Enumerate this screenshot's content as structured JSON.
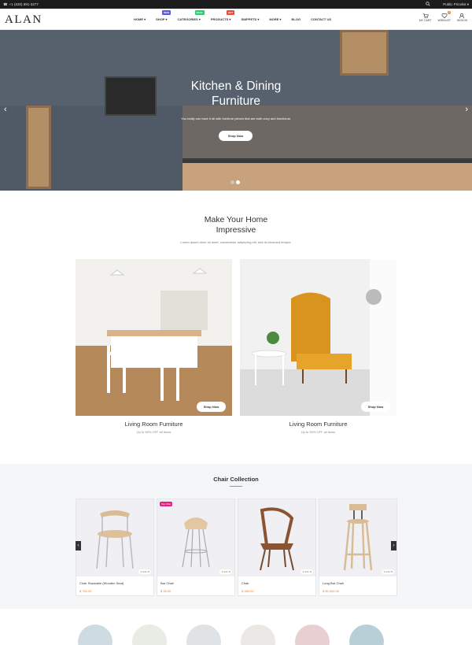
{
  "topbar": {
    "phone": "+1 (630) 891-3277",
    "pricelist": "Public Pricelist"
  },
  "header": {
    "logo": "ALAN",
    "nav": [
      {
        "label": "HOME",
        "caret": "▾",
        "badge": ""
      },
      {
        "label": "SHOP",
        "caret": "▾",
        "badge": "NEW"
      },
      {
        "label": "CATEGORIES",
        "caret": "▾",
        "badge": "SALE"
      },
      {
        "label": "PRODUCTS",
        "caret": "▾",
        "badge": "HOT"
      },
      {
        "label": "SNIPPETS",
        "caret": "▾",
        "badge": ""
      },
      {
        "label": "MORE",
        "caret": "▾",
        "badge": ""
      },
      {
        "label": "BLOG",
        "caret": "",
        "badge": ""
      },
      {
        "label": "CONTACT US",
        "caret": "",
        "badge": ""
      }
    ],
    "icons": {
      "cart": "MY CART",
      "wishlist": "WISHLIST",
      "wishlist_count": "0",
      "signin": "SIGN IN"
    }
  },
  "hero": {
    "title_line1": "Kitchen & Dining",
    "title_line2": "Furniture",
    "subtitle": "You really can have it all with furniture pieces that are both cozy and functional.",
    "button": "Shop Now",
    "prev": "‹",
    "next": "›"
  },
  "intro": {
    "title_line1": "Make Your Home",
    "title_line2": "Impressive",
    "subtitle": "Lorem ipsum dolor sit amet, consectetur adipiscing elit, sed do eiusmod tempor."
  },
  "cards": [
    {
      "title": "Living Room Furniture",
      "subtitle": "Up to 55% OFF all items",
      "button": "Shop Now"
    },
    {
      "title": "Living Room Furniture",
      "subtitle": "Up to 55% OFF all items",
      "button": "Shop Now"
    }
  ],
  "collection": {
    "title": "Chair Collection",
    "products": [
      {
        "name": "Chair Stackable (Wooden Seat)",
        "price": "$ 750.00",
        "rating": "0.0 / 5",
        "tag": ""
      },
      {
        "name": "Bar Chair",
        "price": "$ 28.00",
        "rating": "0.0 / 5",
        "tag": "Top Offer"
      },
      {
        "name": "Chair",
        "price": "$ 280.00",
        "rating": "0.0 / 5",
        "tag": ""
      },
      {
        "name": "Long Bar-Chair",
        "price": "$ 90,000.00",
        "rating": "0.0 / 5",
        "tag": ""
      }
    ],
    "prev": "‹",
    "next": "›"
  },
  "colors": {
    "accent": "#e9812f",
    "badge_new": "#5b5bd6",
    "badge_sale": "#2ecc71",
    "badge_hot": "#e74c3c",
    "tag": "#e91e84"
  }
}
